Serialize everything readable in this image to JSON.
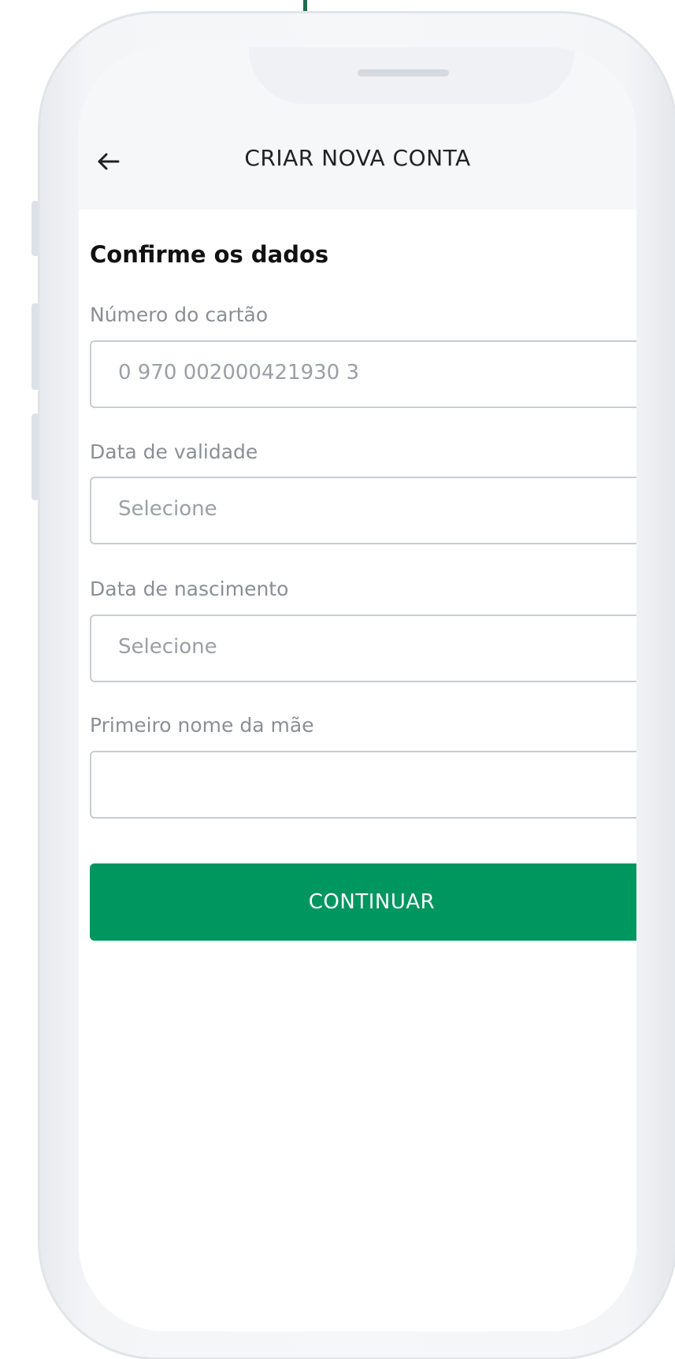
{
  "header": {
    "title": "CRIAR NOVA CONTA",
    "back_icon": "arrow-left-icon"
  },
  "form": {
    "section_title": "Confirme os dados",
    "fields": [
      {
        "label": "Número do cartão",
        "value": "0 970 002000421930 3",
        "placeholder": ""
      },
      {
        "label": "Data de validade",
        "value": "",
        "placeholder": "Selecione"
      },
      {
        "label": "Data de nascimento",
        "value": "",
        "placeholder": "Selecione"
      },
      {
        "label": "Primeiro nome da mãe",
        "value": "",
        "placeholder": ""
      }
    ],
    "continue_label": "CONTINUAR"
  },
  "colors": {
    "accent": "#00965f",
    "header_bg": "#f6f7f9",
    "border": "#c8ccd1"
  }
}
